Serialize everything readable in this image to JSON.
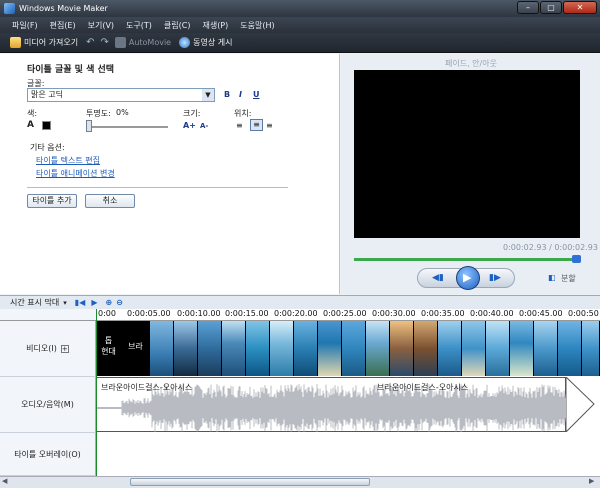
{
  "window": {
    "title": "Windows Movie Maker",
    "min": "–",
    "max": "▢",
    "close": "✕"
  },
  "menu": [
    "파일(F)",
    "편집(E)",
    "보기(V)",
    "도구(T)",
    "클립(C)",
    "재생(P)",
    "도움말(H)"
  ],
  "toolbar": {
    "import": "미디어 가져오기",
    "undo": "↶",
    "redo": "↷",
    "automovie": "AutoMovie",
    "publish": "동영상 게시"
  },
  "panel": {
    "heading": "타이틀 글꼴 및 색 선택",
    "font_label": "글꼴:",
    "font_value": "맑은 고딕",
    "bold": "B",
    "italic": "I",
    "underline": "U",
    "color_label": "색:",
    "transparency_label": "투명도:",
    "transparency_value": "0%",
    "size_label": "크기:",
    "position_label": "위치:",
    "other_label": "기타 옵션:",
    "link_edit_text": "타이틀 텍스트 편집",
    "link_change_anim": "타이틀 애니메이션 변경",
    "add_button": "타이틀 추가",
    "cancel_button": "취소"
  },
  "preview": {
    "title": "페이드, 안/아웃",
    "time": "0:00:02.93 / 0:00:02.93",
    "split": "분할"
  },
  "timeline": {
    "mode": "시간 표시 막대",
    "ticks": [
      "0:00",
      "0:00:05.00",
      "0:00:10.00",
      "0:00:15.00",
      "0:00:20.00",
      "0:00:25.00",
      "0:00:30.00",
      "0:00:35.00",
      "0:00:40.00",
      "0:00:45.00",
      "0:00:50"
    ],
    "tracks": {
      "video": "비디오(I)",
      "audio": "오디오/음악(M)",
      "overlay": "타이틀 오버레이(O)"
    },
    "title_clip_1": "현대",
    "title_clip_2": "브라",
    "title_clip_0": "톱",
    "audio_clip_1": "브라운아이드걸스-오아시스",
    "audio_clip_2": "브라운아이드걸스-오아시스"
  },
  "colors": {
    "accent": "#1e5bb8",
    "seek": "#3aa84b"
  }
}
